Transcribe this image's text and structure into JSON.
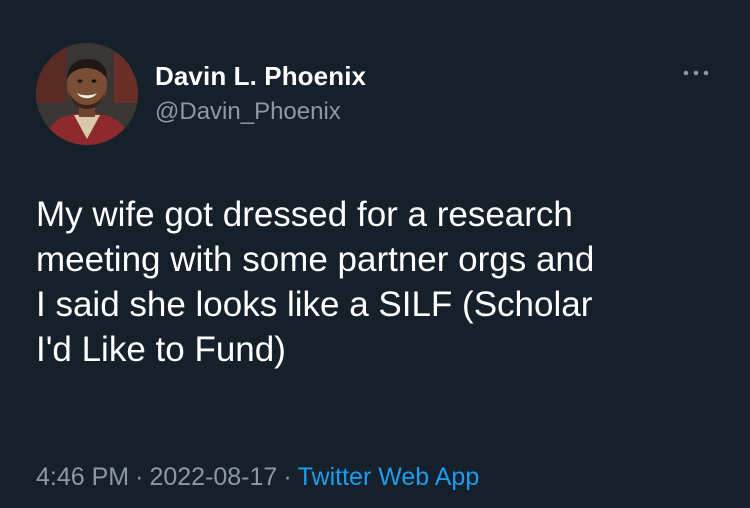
{
  "tweet": {
    "author": {
      "display_name": "Davin L. Phoenix",
      "handle": "@Davin_Phoenix",
      "avatar_icon": "profile-photo"
    },
    "more_icon": "more-horizontal-icon",
    "text": "My wife got dressed for a research\nmeeting with some partner orgs and\nI said she looks like a SILF (Scholar\nI'd Like to Fund)",
    "time": "4:46 PM",
    "date": "2022-08-17",
    "separator": "·",
    "source": "Twitter Web App"
  },
  "colors": {
    "background": "#15202b",
    "primary_text": "#ffffff",
    "secondary_text": "#8b98a5",
    "link": "#1d9bf0"
  }
}
